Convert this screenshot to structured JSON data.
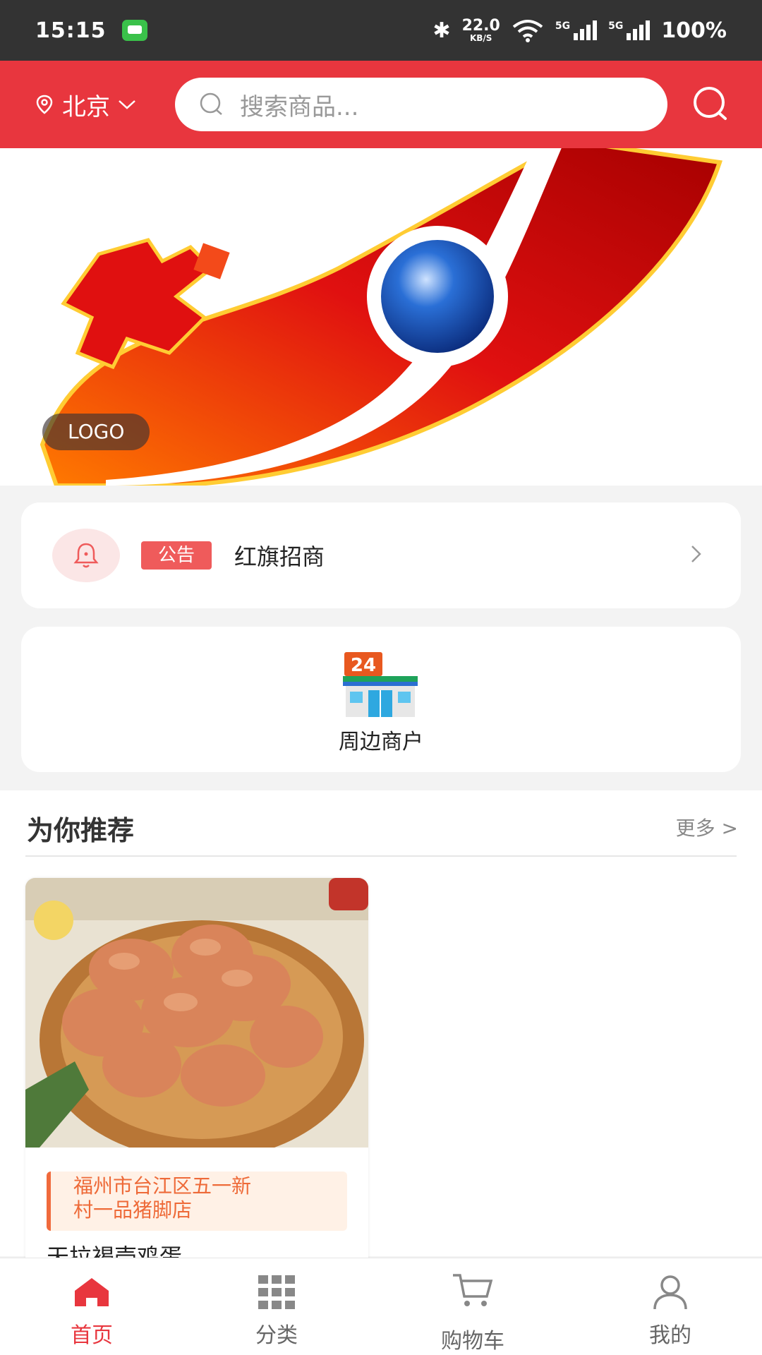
{
  "status_bar": {
    "time": "15:15",
    "net_speed": "22.0",
    "net_unit": "KB/S",
    "signal_label_1": "5G",
    "signal_label_2": "5G",
    "battery": "100%"
  },
  "header": {
    "city": "北京",
    "search_placeholder": "搜索商品..."
  },
  "banner": {
    "tag": "LOGO",
    "slide_count": 1,
    "active_slide": 1
  },
  "notice": {
    "tag": "公告",
    "text": "红旗招商"
  },
  "merchant": {
    "label": "周边商户",
    "icon_number": "24"
  },
  "recommend": {
    "title": "为你推荐",
    "more": "更多 >",
    "products": [
      {
        "store_line1": "福州市台江区五一新",
        "store_line2": "村一品猪脚店",
        "name": "天拉褐壳鸡蛋"
      }
    ]
  },
  "tabs": [
    {
      "label": "首页",
      "active": true
    },
    {
      "label": "分类",
      "active": false
    },
    {
      "label": "购物车",
      "active": false
    },
    {
      "label": "我的",
      "active": false
    }
  ],
  "colors": {
    "brand_red": "#e8363e",
    "notice_tag": "#ef5b5b",
    "store_tag_text": "#ee6a38"
  }
}
